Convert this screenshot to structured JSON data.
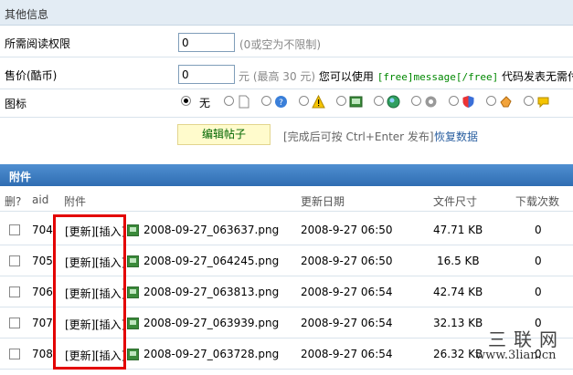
{
  "other_section": {
    "title": "其他信息"
  },
  "read_perm": {
    "label": "所需阅读权限",
    "value": "0",
    "hint": "(0或空为不限制)"
  },
  "price": {
    "label": "售价(酷币)",
    "value": "0",
    "hint_pre": "元 (最高 30 元)",
    "hint_mid": "您可以使用",
    "code": "[free]message[/free]",
    "hint_post": "代码发表无需付费"
  },
  "icon_select": {
    "label": "图标",
    "none_label": "无"
  },
  "actions": {
    "edit_label": "编辑帖子",
    "after_hint": "[完成后可按 Ctrl+Enter 发布]",
    "restore_label": "恢复数据"
  },
  "attachments": {
    "title": "附件",
    "columns": {
      "del": "删?",
      "aid": "aid",
      "file": "附件",
      "date": "更新日期",
      "size": "文件尺寸",
      "downloads": "下载次数"
    },
    "update_label": "[更新]",
    "insert_label": "[插入]",
    "rows": [
      {
        "aid": "704",
        "filename": "2008-09-27_063637.png",
        "date": "2008-9-27 06:50",
        "size": "47.71 KB",
        "downloads": "0"
      },
      {
        "aid": "705",
        "filename": "2008-09-27_064245.png",
        "date": "2008-9-27 06:50",
        "size": "16.5 KB",
        "downloads": "0"
      },
      {
        "aid": "706",
        "filename": "2008-09-27_063813.png",
        "date": "2008-9-27 06:54",
        "size": "42.74 KB",
        "downloads": "0"
      },
      {
        "aid": "707",
        "filename": "2008-09-27_063939.png",
        "date": "2008-9-27 06:54",
        "size": "32.13 KB",
        "downloads": "0"
      },
      {
        "aid": "708",
        "filename": "2008-09-27_063728.png",
        "date": "2008-9-27 06:54",
        "size": "26.32 KB",
        "downloads": "0"
      }
    ]
  },
  "watermark": {
    "chars": "三联网",
    "url": "www.3lian.cn"
  }
}
